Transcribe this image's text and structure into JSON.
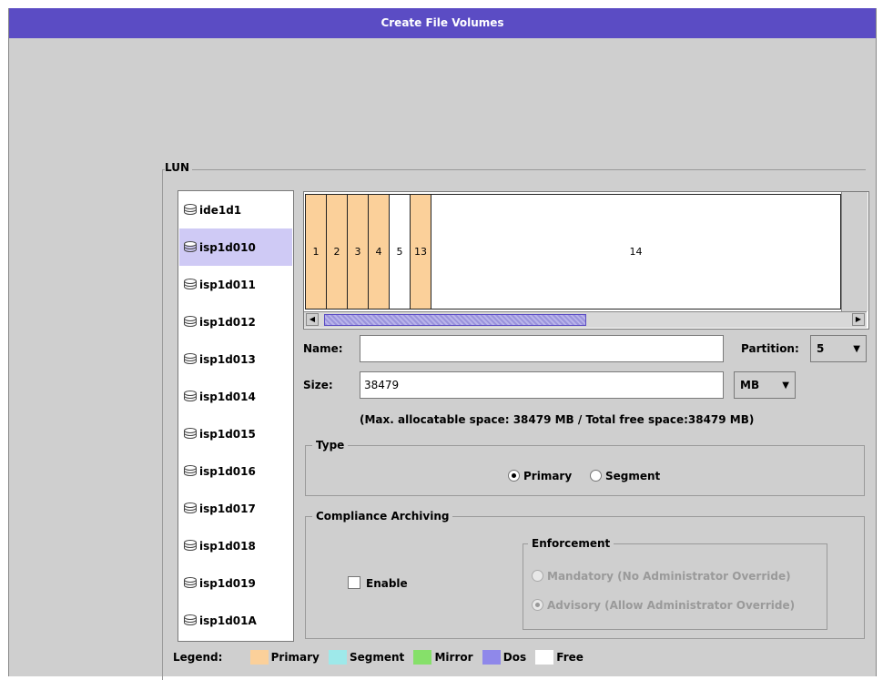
{
  "window": {
    "title": "Create File Volumes"
  },
  "lun": {
    "caption": "LUN",
    "items": [
      "ide1d1",
      "isp1d010",
      "isp1d011",
      "isp1d012",
      "isp1d013",
      "isp1d014",
      "isp1d015",
      "isp1d016",
      "isp1d017",
      "isp1d018",
      "isp1d019",
      "isp1d01A"
    ],
    "selected": "isp1d010"
  },
  "partitions": [
    {
      "label": "1",
      "kind": "primary"
    },
    {
      "label": "2",
      "kind": "primary"
    },
    {
      "label": "3",
      "kind": "primary"
    },
    {
      "label": "4",
      "kind": "primary"
    },
    {
      "label": "5",
      "kind": "free"
    },
    {
      "label": "13",
      "kind": "primary"
    },
    {
      "label": "14",
      "kind": "free"
    }
  ],
  "form": {
    "name_label": "Name:",
    "name_value": "",
    "partition_label": "Partition:",
    "partition_value": "5",
    "size_label": "Size:",
    "size_value": "38479",
    "size_unit": "MB",
    "space_info": "(Max. allocatable space: 38479 MB / Total free space:38479 MB)"
  },
  "type": {
    "caption": "Type",
    "options": [
      {
        "label": "Primary",
        "checked": true
      },
      {
        "label": "Segment",
        "checked": false
      }
    ]
  },
  "compliance": {
    "caption": "Compliance Archiving",
    "enable_label": "Enable",
    "enable_checked": false,
    "enforcement": {
      "caption": "Enforcement",
      "options": [
        {
          "label": "Mandatory (No Administrator Override)",
          "checked": false
        },
        {
          "label": "Advisory (Allow Administrator Override)",
          "checked": true
        }
      ]
    }
  },
  "legend": {
    "label": "Legend:",
    "items": [
      {
        "label": "Primary",
        "color": "#fbd09a"
      },
      {
        "label": "Segment",
        "color": "#9ee9ea"
      },
      {
        "label": "Mirror",
        "color": "#86e06a"
      },
      {
        "label": "Dos",
        "color": "#8f88ea"
      },
      {
        "label": "Free",
        "color": "#ffffff"
      }
    ]
  },
  "colors": {
    "titlebar": "#5b4cc4",
    "background": "#cfcfcf",
    "selection": "#cfcaf5"
  }
}
